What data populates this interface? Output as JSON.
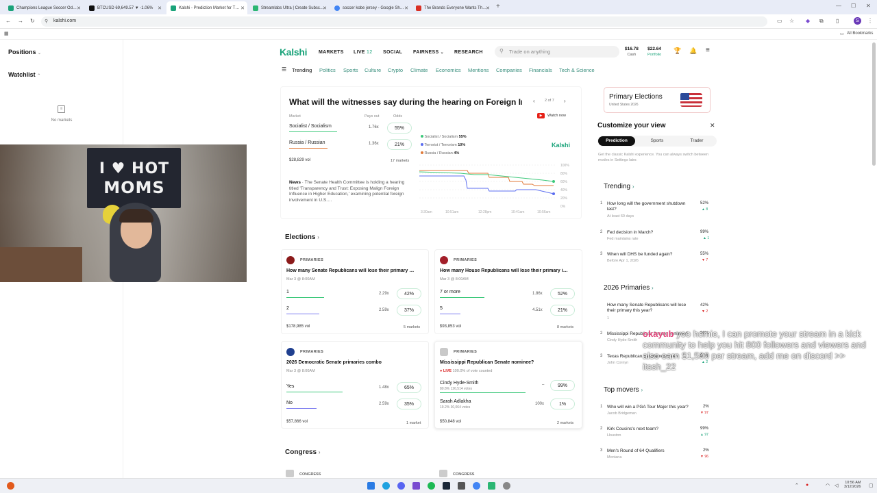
{
  "browser": {
    "tabs": [
      {
        "label": "Champions League Soccer Od…",
        "color": "#1aa37a"
      },
      {
        "label": "BTCUSD 69,649.57 ▼ -1.06%",
        "color": "#111111"
      },
      {
        "label": "Kalshi - Prediction Market for T…",
        "color": "#1aa37a"
      },
      {
        "label": "Streamlabs Ultra | Create Subsc…",
        "color": "#2bb673"
      },
      {
        "label": "soccer kobe jersey - Google Sh…",
        "color": "#4285f4"
      },
      {
        "label": "The Brands Everyone Wants Th…",
        "color": "#d93025"
      }
    ],
    "url": "kalshi.com",
    "all_bookmarks": "All Bookmarks",
    "profile_initial": "S"
  },
  "left": {
    "positions": "Positions",
    "watchlist": "Watchlist",
    "no_markets": "No markets"
  },
  "webcam": {
    "banner_line1": "I ♥ HOT",
    "banner_line2": "MOMS"
  },
  "nav": {
    "logo": "Kalshi",
    "links": [
      "MARKETS",
      "LIVE",
      "SOCIAL",
      "FAIRNESS",
      "RESEARCH"
    ],
    "live_count": "12",
    "search_placeholder": "Trade on anything",
    "cash_value": "$16.78",
    "cash_label": "Cash",
    "portfolio_value": "$22.64",
    "portfolio_label": "Portfolio",
    "categories": [
      "Trending",
      "Politics",
      "Sports",
      "Culture",
      "Crypto",
      "Climate",
      "Economics",
      "Mentions",
      "Companies",
      "Financials",
      "Tech & Science"
    ]
  },
  "featured": {
    "title": "What will the witnesses say during the hearing on Foreign Inf…",
    "pager": "2 of 7",
    "watch_now": "Watch now",
    "col_market": "Market",
    "col_pays": "Pays out",
    "col_odds": "Odds",
    "rows": [
      {
        "label": "Socialist / Socialism",
        "pays": "1.76x",
        "odds": "55%"
      },
      {
        "label": "Russia / Russian",
        "pays": "1.36x",
        "odds": "21%"
      }
    ],
    "volume": "$28,829 vol",
    "markets": "17 markets",
    "news_label": "News",
    "news_text": "· The Senate Health Committee is holding a hearing titled 'Transparency and Trust: Exposing Malign Foreign Influence in Higher Education,' examining potential foreign involvement in U.S.…",
    "legend": [
      {
        "label": "Socialist / Socialism",
        "value": "55%",
        "color": "#3cc87a"
      },
      {
        "label": "Terrorist / Terrorism",
        "value": "10%",
        "color": "#5b6df0"
      },
      {
        "label": "Russia / Russian",
        "value": "4%",
        "color": "#e07a3a"
      }
    ],
    "brand": "Kalshi",
    "y_ticks": [
      "100%",
      "80%",
      "60%",
      "40%",
      "20%",
      "0%"
    ],
    "x_ticks": [
      "3:30am",
      "10:51am",
      "12:28pm",
      "10:41am",
      "10:56am"
    ]
  },
  "sections": {
    "elections": "Elections",
    "congress": "Congress"
  },
  "markets": [
    {
      "tag": "PRIMARIES",
      "title": "How many Senate Republicans will lose their primary …",
      "date": "Mar 3 @ 8:00AM",
      "rows": [
        {
          "label": "1",
          "pays": "2.29x",
          "odds": "42%"
        },
        {
          "label": "2",
          "pays": "2.59x",
          "odds": "37%"
        }
      ],
      "volume": "$178,985 vol",
      "count": "5 markets"
    },
    {
      "tag": "PRIMARIES",
      "title": "How many House Republicans will lose their primary i…",
      "date": "Mar 3 @ 8:00AM",
      "rows": [
        {
          "label": "7 or more",
          "pays": "1.86x",
          "odds": "52%"
        },
        {
          "label": "5",
          "pays": "4.51x",
          "odds": "21%"
        }
      ],
      "volume": "$93,853 vol",
      "count": "8 markets"
    },
    {
      "tag": "PRIMARIES",
      "title": "2026 Democratic Senate primaries combo",
      "date": "Mar 3 @ 8:00AM",
      "rows": [
        {
          "label": "Yes",
          "pays": "1.48x",
          "odds": "65%"
        },
        {
          "label": "No",
          "pays": "2.59x",
          "odds": "35%"
        }
      ],
      "volume": "$57,866 vol",
      "count": "1 market"
    },
    {
      "tag": "PRIMARIES",
      "title": "Mississippi Republican Senate nominee?",
      "live": "LIVE",
      "counted": "100.0% of vote counted",
      "rows": [
        {
          "label": "Cindy Hyde-Smith",
          "sub": "80.8%  126,514 votes",
          "pays": "",
          "odds": "99%"
        },
        {
          "label": "Sarah Adlakha",
          "sub": "19.2%  30,064 votes",
          "pays": "100x",
          "odds": "1%"
        }
      ],
      "volume": "$50,848 vol",
      "count": "2 markets"
    }
  ],
  "congress_tag": "CONGRESS",
  "right": {
    "promo_title": "Primary Elections",
    "promo_sub": "United States 2026",
    "customize_title": "Customize your view",
    "modes": [
      "Prediction",
      "Sports",
      "Trader"
    ],
    "customize_note": "Get the classic Kalshi experience. You can always switch between modes in Settings later.",
    "trending_title": "Trending",
    "trending": [
      {
        "n": "1",
        "title": "How long will the government shutdown last?",
        "sub": "At least 60 days",
        "pct": "52%",
        "chg": "▲ 8",
        "up": true
      },
      {
        "n": "2",
        "title": "Fed decision in March?",
        "sub": "Fed maintains rate",
        "pct": "99%",
        "chg": "▲ 1",
        "up": true
      },
      {
        "n": "3",
        "title": "When will DHS be funded again?",
        "sub": "Before Apr 1, 2026",
        "pct": "55%",
        "chg": "▼ 7",
        "up": false
      }
    ],
    "primaries_title": "2026 Primaries",
    "primaries": [
      {
        "n": "",
        "title": "How many Senate Republicans will lose their primary this year?",
        "sub": "1",
        "pct": "42%",
        "chg": "▼ 2",
        "up": false
      },
      {
        "n": "2",
        "title": "Mississippi Republican Senate nominee?",
        "sub": "Cindy Hyde-Smith",
        "pct": "99%",
        "chg": "",
        "up": true
      },
      {
        "n": "3",
        "title": "Texas Republican Senate nominee?",
        "sub": "John Cornyn",
        "pct": "58%",
        "chg": "▲ 2",
        "up": true
      }
    ],
    "movers_title": "Top movers",
    "movers": [
      {
        "n": "1",
        "title": "Who will win a PGA Tour Major this year?",
        "sub": "Jacob Bridgeman",
        "pct": "2%",
        "chg": "▼ 97",
        "up": false
      },
      {
        "n": "2",
        "title": "Kirk Cousins's next team?",
        "sub": "Houston",
        "pct": "99%",
        "chg": "▲ 97",
        "up": true
      },
      {
        "n": "3",
        "title": "Men's Round of 64 Qualifiers",
        "sub": "Montana",
        "pct": "2%",
        "chg": "▼ 96",
        "up": false
      }
    ]
  },
  "overlay": {
    "user": "okayub",
    "message": "yoo homie, I can promote your stream in a kick community to help you hit 800 followers and viewers and also earn $1,500 per stream, add me on discord >> itssh_22"
  },
  "taskbar": {
    "time": "10:56 AM",
    "date": "3/12/2026"
  }
}
